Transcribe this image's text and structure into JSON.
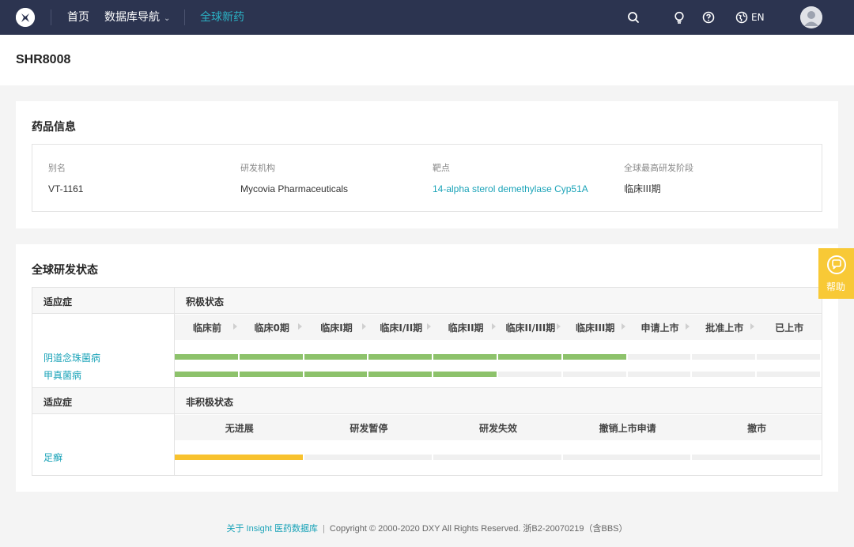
{
  "nav": {
    "home": "首页",
    "db_nav": "数据库导航",
    "global_drugs": "全球新药",
    "lang": "EN"
  },
  "page": {
    "title": "SHR8008"
  },
  "drug_info": {
    "title": "药品信息",
    "fields": [
      {
        "label": "别名",
        "value": "VT-1161"
      },
      {
        "label": "研发机构",
        "value": "Mycovia Pharmaceuticals"
      },
      {
        "label": "靶点",
        "value": "14-alpha sterol demethylase Cyp51A"
      },
      {
        "label": "全球最高研发阶段",
        "value": "临床III期"
      }
    ]
  },
  "global_status": {
    "title": "全球研发状态",
    "active": {
      "left_header": "适应症",
      "right_header": "积极状态",
      "phases": [
        "临床前",
        "临床0期",
        "临床I期",
        "临床I/II期",
        "临床II期",
        "临床II/III期",
        "临床III期",
        "申请上市",
        "批准上市",
        "已上市"
      ],
      "indications": [
        {
          "name": "阴道念珠菌病",
          "progress_segments": 7
        },
        {
          "name": "甲真菌病",
          "progress_segments": 5
        }
      ]
    },
    "inactive": {
      "left_header": "适应症",
      "right_header": "非积极状态",
      "statuses": [
        "无进展",
        "研发暂停",
        "研发失效",
        "撤销上市申请",
        "撤市"
      ],
      "indications": [
        {
          "name": "足癣",
          "progress_segments": 1
        }
      ]
    }
  },
  "help": {
    "label": "帮助"
  },
  "footer": {
    "about_link": "关于 Insight 医药数据库",
    "copyright": "Copyright © 2000-2020 DXY All Rights Reserved. 浙B2-20070219（含BBS）"
  },
  "colors": {
    "nav_bg": "#2c3450",
    "accent": "#1aa3b8",
    "active_bar": "#8dc26b",
    "inactive_bar": "#f8c22e",
    "help_bg": "#f8c936"
  }
}
